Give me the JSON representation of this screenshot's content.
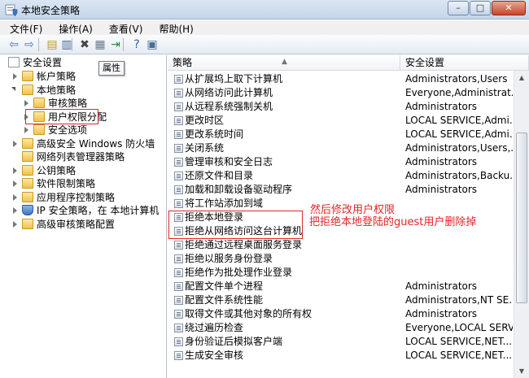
{
  "window": {
    "title": "本地安全策略",
    "controls": [
      "–",
      "□",
      "✕"
    ]
  },
  "menu": [
    "文件(F)",
    "操作(A)",
    "查看(V)",
    "帮助(H)"
  ],
  "toolbar": {
    "icons": [
      {
        "name": "back-icon",
        "glyph": "⇦",
        "color": "#3a7bd5"
      },
      {
        "name": "forward-icon",
        "glyph": "⇨",
        "color": "#3a7bd5"
      },
      {
        "name": "up-folder-icon",
        "glyph": "▤",
        "color": "#c9952a"
      },
      {
        "name": "show-hide-tree-icon",
        "glyph": "▥",
        "color": "#4a6d96"
      },
      {
        "name": "delete-icon",
        "glyph": "✖",
        "color": "#444444"
      },
      {
        "name": "properties-icon",
        "glyph": "▦",
        "color": "#6b7a8d"
      },
      {
        "name": "export-list-icon",
        "glyph": "⇥",
        "color": "#2f8a3a"
      },
      {
        "name": "help-icon",
        "glyph": "?",
        "color": "#2d5ea8"
      },
      {
        "name": "console-icon",
        "glyph": "▣",
        "color": "#4a6d96"
      }
    ]
  },
  "tree": {
    "root": "安全设置",
    "items": [
      {
        "label": "帐户策略",
        "icon": "folder",
        "twisty": "closed",
        "level": 1
      },
      {
        "label": "本地策略",
        "icon": "folder",
        "twisty": "open",
        "level": 1
      },
      {
        "label": "审核策略",
        "icon": "folder",
        "twisty": "closed",
        "level": 2
      },
      {
        "label": "用户权限分配",
        "icon": "folder",
        "twisty": "closed",
        "level": 2
      },
      {
        "label": "安全选项",
        "icon": "folder",
        "twisty": "closed",
        "level": 2
      },
      {
        "label": "高级安全 Windows 防火墙",
        "icon": "folder",
        "twisty": "closed",
        "level": 1
      },
      {
        "label": "网络列表管理器策略",
        "icon": "folder",
        "twisty": "none",
        "level": 1
      },
      {
        "label": "公钥策略",
        "icon": "folder",
        "twisty": "closed",
        "level": 1
      },
      {
        "label": "软件限制策略",
        "icon": "folder",
        "twisty": "closed",
        "level": 1
      },
      {
        "label": "应用程序控制策略",
        "icon": "folder",
        "twisty": "closed",
        "level": 1
      },
      {
        "label": "IP 安全策略，在 本地计算机",
        "icon": "shield",
        "twisty": "closed",
        "level": 1
      },
      {
        "label": "高级审核策略配置",
        "icon": "folder",
        "twisty": "closed",
        "level": 1
      }
    ]
  },
  "tooltip": "属性",
  "list": {
    "headers": [
      "策略",
      "安全设置"
    ],
    "rows": [
      {
        "policy": "从扩展坞上取下计算机",
        "setting": "Administrators,Users"
      },
      {
        "policy": "从网络访问此计算机",
        "setting": "Everyone,Administrat..."
      },
      {
        "policy": "从远程系统强制关机",
        "setting": "Administrators"
      },
      {
        "policy": "更改时区",
        "setting": "LOCAL SERVICE,Admi..."
      },
      {
        "policy": "更改系统时间",
        "setting": "LOCAL SERVICE,Admi..."
      },
      {
        "policy": "关闭系统",
        "setting": "Administrators,Users,..."
      },
      {
        "policy": "管理审核和安全日志",
        "setting": "Administrators"
      },
      {
        "policy": "还原文件和目录",
        "setting": "Administrators,Backu..."
      },
      {
        "policy": "加载和卸载设备驱动程序",
        "setting": "Administrators"
      },
      {
        "policy": "将工作站添加到域",
        "setting": ""
      },
      {
        "policy": "拒绝本地登录",
        "setting": ""
      },
      {
        "policy": "拒绝从网络访问这台计算机",
        "setting": ""
      },
      {
        "policy": "拒绝通过远程桌面服务登录",
        "setting": ""
      },
      {
        "policy": "拒绝以服务身份登录",
        "setting": ""
      },
      {
        "policy": "拒绝作为批处理作业登录",
        "setting": ""
      },
      {
        "policy": "配置文件单个进程",
        "setting": "Administrators"
      },
      {
        "policy": "配置文件系统性能",
        "setting": "Administrators,NT SE..."
      },
      {
        "policy": "取得文件或其他对象的所有权",
        "setting": "Administrators"
      },
      {
        "policy": "绕过遍历检查",
        "setting": "Everyone,LOCAL SERVI..."
      },
      {
        "policy": "身份验证后模拟客户端",
        "setting": "LOCAL SERVICE,NET..."
      },
      {
        "policy": "生成安全审核",
        "setting": "LOCAL SERVICE,NET..."
      }
    ]
  },
  "annotations": {
    "line1": "然后修改用户权限",
    "line2": "把拒绝本地登陆的guest用户删除掉",
    "color": "#e1252a"
  }
}
